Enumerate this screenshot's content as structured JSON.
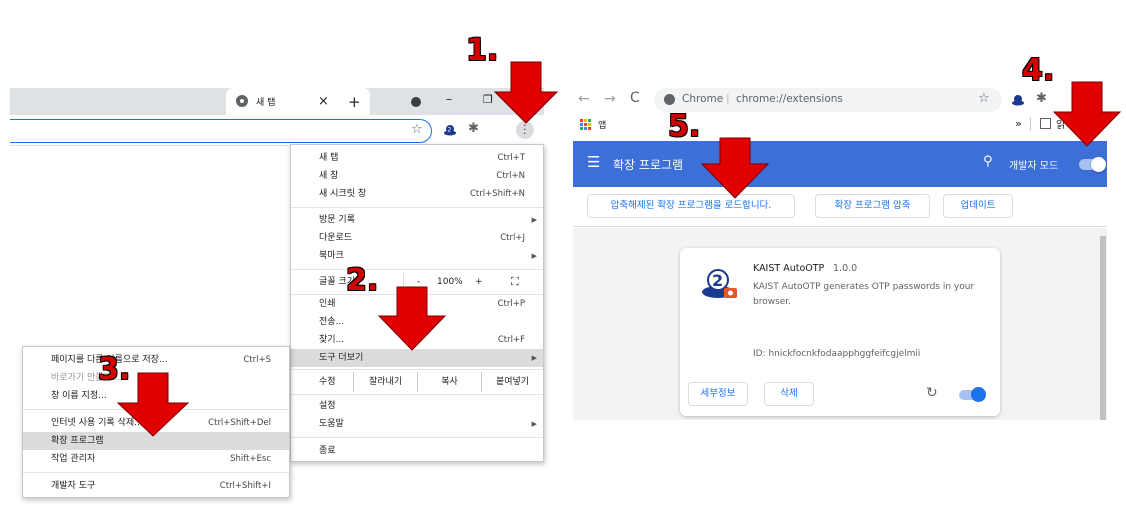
{
  "left_browser": {
    "tab_title": "새 탭",
    "tab_close": "×",
    "new_tab": "+",
    "minimize": "–",
    "maximize": "❐"
  },
  "chrome_menu": {
    "items": [
      {
        "label": "새 탭",
        "shortcut": "Ctrl+T"
      },
      {
        "label": "새 창",
        "shortcut": "Ctrl+N"
      },
      {
        "label": "새 시크릿 창",
        "shortcut": "Ctrl+Shift+N"
      },
      {
        "label": "방문 기록",
        "shortcut": ""
      },
      {
        "label": "다운로드",
        "shortcut": "Ctrl+J"
      },
      {
        "label": "북마크",
        "shortcut": ""
      },
      {
        "label": "글꼴 크기",
        "shortcut": ""
      },
      {
        "label": "인쇄",
        "shortcut": "Ctrl+P"
      },
      {
        "label": "전송...",
        "shortcut": ""
      },
      {
        "label": "찾기...",
        "shortcut": "Ctrl+F"
      },
      {
        "label": "도구 더보기",
        "shortcut": ""
      },
      {
        "label": "설정",
        "shortcut": ""
      },
      {
        "label": "도움말",
        "shortcut": ""
      },
      {
        "label": "종료",
        "shortcut": ""
      }
    ],
    "zoom": {
      "minus": "-",
      "value": "100%",
      "plus": "+",
      "fullscreen": "⛶"
    },
    "edit": {
      "label": "수정",
      "cut": "잘라내기",
      "copy": "복사",
      "paste": "붙여넣기"
    }
  },
  "more_tools_menu": {
    "items": [
      {
        "label": "페이지를 다른 이름으로 저장...",
        "shortcut": "Ctrl+S"
      },
      {
        "label": "바로가기 만들기...",
        "shortcut": ""
      },
      {
        "label": "창 이름 지정...",
        "shortcut": ""
      },
      {
        "label": "인터넷 사용 기록 삭제...",
        "shortcut": "Ctrl+Shift+Del"
      },
      {
        "label": "확장 프로그램",
        "shortcut": ""
      },
      {
        "label": "작업 관리자",
        "shortcut": "Shift+Esc"
      },
      {
        "label": "개발자 도구",
        "shortcut": "Ctrl+Shift+I"
      }
    ]
  },
  "right_browser": {
    "omnibox_site": "Chrome",
    "omnibox_separator": "|",
    "omnibox_url": "chrome://extensions",
    "bookmarks_apps": "앱",
    "bookmarks_more": "»",
    "bookmarks_folder": "읽"
  },
  "extensions_page": {
    "header_title": "확장 프로그램",
    "dev_mode_label": "개발자 모드",
    "dev_mode_on": true,
    "load_unpacked": "압축해제된 확장 프로그램을 로드합니다.",
    "pack_extension": "확장 프로그램 압축",
    "update": "업데이트",
    "card": {
      "name": "KAIST AutoOTP",
      "version": "1.0.0",
      "description": "KAIST AutoOTP generates OTP passwords in your browser.",
      "id_text": "ID: hnickfocnkfodaapphggfeifcgjelmii",
      "details": "세부정보",
      "remove": "삭제",
      "enabled": true
    },
    "accent_color": "#3d6fd8"
  },
  "step_labels": {
    "s1": "1.",
    "s2": "2.",
    "s3": "3.",
    "s4": "4.",
    "s5": "5."
  },
  "arrow_color": "#e00000"
}
